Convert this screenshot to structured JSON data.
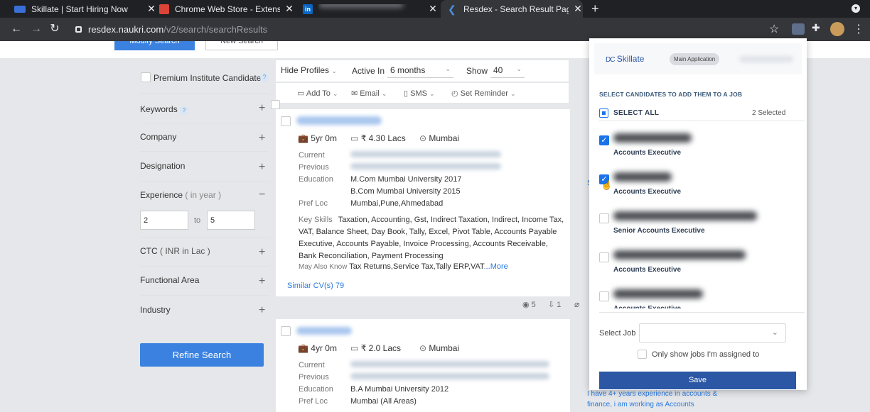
{
  "browser": {
    "tabs": [
      {
        "title": "Skillate | Start Hiring Now",
        "close": "✕",
        "color": "#3b6fd8"
      },
      {
        "title": "Chrome Web Store - Extension",
        "close": "✕",
        "color": "#db4437"
      },
      {
        "title": "",
        "close": "✕",
        "color": "#0a66c2",
        "favicon_text": "in"
      },
      {
        "title": "Resdex - Search Result Page",
        "close": "✕",
        "color": "#4a90e2"
      }
    ],
    "new_tab": "+",
    "url_domain": "resdex.naukri.com",
    "url_path": "/v2/search/searchResults"
  },
  "top_buttons": {
    "modify": "Modify Search",
    "new": "New Search"
  },
  "filters": {
    "premium": "Premium Institute Candidates",
    "help": "?",
    "keywords": "Keywords",
    "company": "Company",
    "designation": "Designation",
    "experience": "Experience",
    "experience_unit": "( in year )",
    "exp_from": "2",
    "exp_to_label": "to",
    "exp_to": "5",
    "ctc": "CTC",
    "ctc_unit": "( INR in Lac )",
    "functional_area": "Functional Area",
    "industry": "Industry",
    "refine": "Refine Search",
    "plus": "+",
    "minus": "−"
  },
  "toolbar": {
    "hide_profiles": "Hide Profiles",
    "active_in_label": "Active In",
    "active_in_value": "6 months",
    "show_label": "Show",
    "show_value": "40",
    "add_to": "Add To",
    "email": "Email",
    "sms": "SMS",
    "set_reminder": "Set Reminder"
  },
  "results": [
    {
      "experience": "5yr 0m",
      "salary": "₹ 4.30 Lacs",
      "location": "Mumbai",
      "labels": {
        "current": "Current",
        "previous": "Previous",
        "education": "Education",
        "pref_loc": "Pref Loc",
        "key_skills": "Key Skills",
        "may_also_know": "May Also Know"
      },
      "education": [
        "M.Com Mumbai University 2017",
        "B.Com Mumbai University 2015"
      ],
      "pref_loc": "Mumbai,Pune,Ahmedabad",
      "key_skills": "Taxation, Accounting, Gst, Indirect Taxation, Indirect, Income Tax, VAT, Balance Sheet, Day Book, Tally, Excel, Pivot Table, Accounts Payable Executive, Accounts Payable, Invoice Processing, Accounts Receivable, Bank Reconciliation, Payment Processing",
      "may_also_know": "Tax Returns,Service Tax,Tally ERP,VAT",
      "more": "...More",
      "similar": "Similar CV(s) 79",
      "views": "5",
      "downloads": "1"
    },
    {
      "experience": "4yr 0m",
      "salary": "₹ 2.0 Lacs",
      "location": "Mumbai",
      "labels": {
        "current": "Current",
        "previous": "Previous",
        "education": "Education",
        "pref_loc": "Pref Loc"
      },
      "education": [
        "B.A Mumbai University 2012"
      ],
      "pref_loc": "Mumbai (All Areas)",
      "summary": "I have 4+ years experience in accounts & finance, i am working as Accounts"
    }
  ],
  "panel": {
    "brand": "Skillate",
    "tag": "Main Application",
    "instruction": "SELECT CANDIDATES TO ADD THEM TO A JOB",
    "select_all": "SELECT ALL",
    "selected_count": "2 Selected",
    "candidates": [
      {
        "title": "Accounts Executive",
        "checked": true
      },
      {
        "title": "Accounts Executive",
        "checked": true
      },
      {
        "title": "Senior Accounts Executive",
        "checked": false
      },
      {
        "title": "Accounts Executive",
        "checked": false
      },
      {
        "title": "Accounts Executive",
        "checked": false
      }
    ],
    "select_job_label": "Select Job",
    "only_mine": "Only show jobs I'm assigned to",
    "save": "Save"
  },
  "colors": {
    "primary": "#3b82e0",
    "save": "#2b57a5",
    "link": "#2a7ae2"
  }
}
